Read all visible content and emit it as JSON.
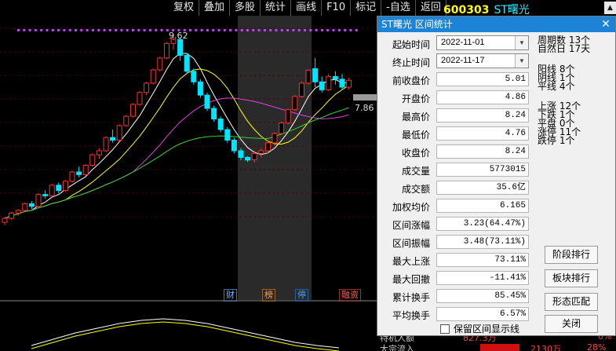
{
  "toolbar": {
    "buttons": [
      "复权",
      "叠加",
      "多股",
      "统计",
      "画线",
      "F10",
      "标记",
      "-自选",
      "返回"
    ]
  },
  "ticker": {
    "code": "600303",
    "name": "ST曙光"
  },
  "chart": {
    "high_label": "9.62",
    "current_label": "7.86",
    "event_markers": [
      "财",
      "榜",
      "停",
      "融资"
    ],
    "colors": {
      "up": "#ff3030",
      "down": "#00e5ff",
      "ma_white": "#ffffff",
      "ma_yellow": "#ffff00",
      "ma_magenta": "#e040e0",
      "ma_green": "#34d234",
      "shade": "#2a2a2a",
      "accent": "#1d83d6"
    }
  },
  "chart_data": {
    "type": "candlestick",
    "series": [
      {
        "name": "",
        "ohlc": [
          [
            2.5,
            2.7,
            2.4,
            2.65
          ],
          [
            2.65,
            2.9,
            2.6,
            2.85
          ],
          [
            2.85,
            3.0,
            2.75,
            2.95
          ],
          [
            2.95,
            3.25,
            2.9,
            3.2
          ],
          [
            3.2,
            3.3,
            3.0,
            3.1
          ],
          [
            3.1,
            3.6,
            3.05,
            3.55
          ],
          [
            3.55,
            3.7,
            3.4,
            3.5
          ],
          [
            3.5,
            3.95,
            3.45,
            3.9
          ],
          [
            3.9,
            4.0,
            3.6,
            3.7
          ],
          [
            3.7,
            4.1,
            3.65,
            4.05
          ],
          [
            4.05,
            4.45,
            4.0,
            4.4
          ],
          [
            4.4,
            4.6,
            4.2,
            4.3
          ],
          [
            4.3,
            4.7,
            4.25,
            4.65
          ],
          [
            4.65,
            5.1,
            4.6,
            5.05
          ],
          [
            5.05,
            5.3,
            4.9,
            5.2
          ],
          [
            5.2,
            5.75,
            5.15,
            5.7
          ],
          [
            5.7,
            6.0,
            5.5,
            5.6
          ],
          [
            5.6,
            6.2,
            5.55,
            6.15
          ],
          [
            6.15,
            6.55,
            6.1,
            6.5
          ],
          [
            6.5,
            7.0,
            6.45,
            6.95
          ],
          [
            6.95,
            7.45,
            6.9,
            7.4
          ],
          [
            7.4,
            7.8,
            7.3,
            7.75
          ],
          [
            7.75,
            8.3,
            7.7,
            8.25
          ],
          [
            8.25,
            8.75,
            8.2,
            8.7
          ],
          [
            8.7,
            9.3,
            8.65,
            9.25
          ],
          [
            9.25,
            9.62,
            9.0,
            9.4
          ],
          [
            9.4,
            9.45,
            8.6,
            8.8
          ],
          [
            8.8,
            8.9,
            8.1,
            8.2
          ],
          [
            8.2,
            8.3,
            7.7,
            7.8
          ],
          [
            7.8,
            7.9,
            7.2,
            7.3
          ],
          [
            7.3,
            7.4,
            6.7,
            6.8
          ],
          [
            6.8,
            6.9,
            6.3,
            6.4
          ],
          [
            6.4,
            6.5,
            5.9,
            6.0
          ],
          [
            6.0,
            6.1,
            5.5,
            5.6
          ],
          [
            5.6,
            5.7,
            5.1,
            5.2
          ],
          [
            5.2,
            5.3,
            4.85,
            4.95
          ],
          [
            4.95,
            5.0,
            4.78,
            4.85
          ],
          [
            4.86,
            5.2,
            4.76,
            5.1
          ],
          [
            5.1,
            5.3,
            4.95,
            5.2
          ],
          [
            5.2,
            5.6,
            5.1,
            5.5
          ],
          [
            5.5,
            5.9,
            5.4,
            5.85
          ],
          [
            5.85,
            6.3,
            5.8,
            6.25
          ],
          [
            6.25,
            6.8,
            6.2,
            6.75
          ],
          [
            6.75,
            7.3,
            6.7,
            7.25
          ],
          [
            7.25,
            7.8,
            7.2,
            7.75
          ],
          [
            7.75,
            8.24,
            7.7,
            8.24
          ],
          [
            8.3,
            8.7,
            7.6,
            7.8
          ],
          [
            7.8,
            8.0,
            7.4,
            7.5
          ],
          [
            7.5,
            8.1,
            7.45,
            8.0
          ],
          [
            8.0,
            8.2,
            7.7,
            7.9
          ],
          [
            7.9,
            8.1,
            7.5,
            7.6
          ],
          [
            7.6,
            7.95,
            7.5,
            7.86
          ]
        ]
      }
    ]
  },
  "dialog": {
    "title": "ST曙光 区间统计",
    "close_icon": "close-icon",
    "start_label": "起始时间",
    "start_date": "2022-11-01",
    "end_label": "终止时间",
    "end_date": "2022-11-17",
    "rows": [
      {
        "label": "前收盘价",
        "value": "5.01"
      },
      {
        "label": "开盘价",
        "value": "4.86"
      },
      {
        "label": "最高价",
        "value": "8.24"
      },
      {
        "label": "最低价",
        "value": "4.76"
      },
      {
        "label": "收盘价",
        "value": "8.24"
      },
      {
        "label": "成交量",
        "value": "5773015"
      },
      {
        "label": "成交额",
        "value": "35.6亿"
      },
      {
        "label": "加权均价",
        "value": "6.165"
      },
      {
        "label": "区间涨幅",
        "value": "3.23(64.47%)"
      },
      {
        "label": "区间振幅",
        "value": "3.48(73.11%)"
      },
      {
        "label": "最大上涨",
        "value": "73.11%"
      },
      {
        "label": "最大回撤",
        "value": "-11.41%"
      },
      {
        "label": "累计换手",
        "value": "85.45%"
      },
      {
        "label": "平均换手",
        "value": "6.57%"
      }
    ],
    "period_stats": [
      "周期数 13个",
      "自然日 17天"
    ],
    "candle_stats": [
      "阳线 8个",
      "阴线 1个",
      "平线 4个"
    ],
    "move_stats": [
      "上涨 12个",
      "下跌 1个",
      "平盘 0个",
      "涨停 11个",
      "跌停 1个"
    ],
    "buttons": [
      "阶段排行",
      "板块排行",
      "形态匹配",
      "关闭"
    ],
    "keep_checkbox": "保留区间显示线"
  },
  "bottom_strip": {
    "left_text": "特机人额",
    "mid_text": "827.3万",
    "pct_text": "0%",
    "left_text2": "大宗流入",
    "mid_text2": "2130万",
    "pct_text2": "28%"
  }
}
